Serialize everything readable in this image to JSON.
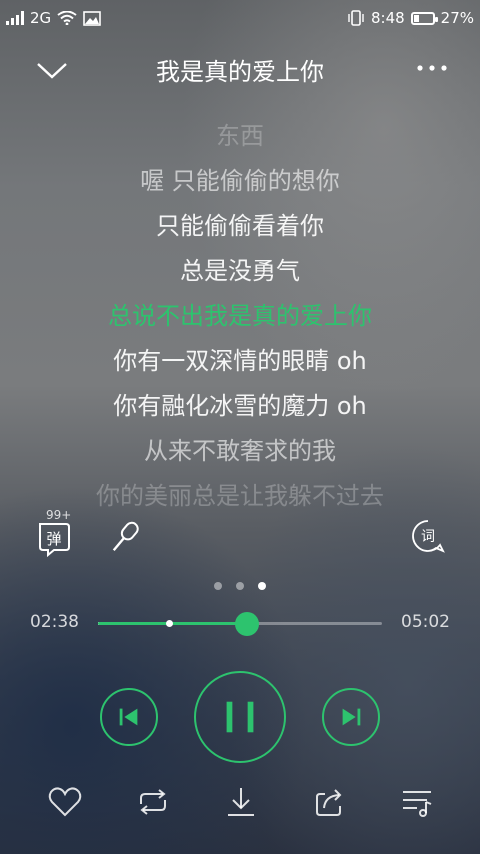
{
  "status": {
    "network": "2G",
    "time": "8:48",
    "battery": "27%",
    "battery_level": 0.27,
    "icons": [
      "signal-icon",
      "wifi-icon",
      "image-icon",
      "vibrate-icon",
      "battery-icon"
    ]
  },
  "song": {
    "title": "我是真的爱上你"
  },
  "lyrics": {
    "lines": [
      {
        "text": "东西",
        "state": "far"
      },
      {
        "text": "喔 只能偷偷的想你",
        "state": "near"
      },
      {
        "text": "只能偷偷看着你",
        "state": "normal"
      },
      {
        "text": "总是没勇气",
        "state": "normal"
      },
      {
        "text": "总说不出我是真的爱上你",
        "state": "current"
      },
      {
        "text": "你有一双深情的眼睛 oh",
        "state": "normal"
      },
      {
        "text": "你有融化冰雪的魔力 oh",
        "state": "normal"
      },
      {
        "text": "从来不敢奢求的我",
        "state": "near"
      },
      {
        "text": "你的美丽总是让我躲不过去",
        "state": "far"
      }
    ],
    "highlight_color": "#2dc36e"
  },
  "danmu": {
    "label": "弹",
    "badge": "99+"
  },
  "lyric_button": {
    "label": "词"
  },
  "pager": {
    "count": 3,
    "active": 2
  },
  "progress": {
    "current": "02:38",
    "total": "05:02",
    "played_fraction": 0.523,
    "buffered_fraction": 0.25
  },
  "colors": {
    "accent": "#2dc36e"
  },
  "bottom_actions": [
    "heart-icon",
    "repeat-icon",
    "download-icon",
    "share-icon",
    "playlist-icon"
  ]
}
